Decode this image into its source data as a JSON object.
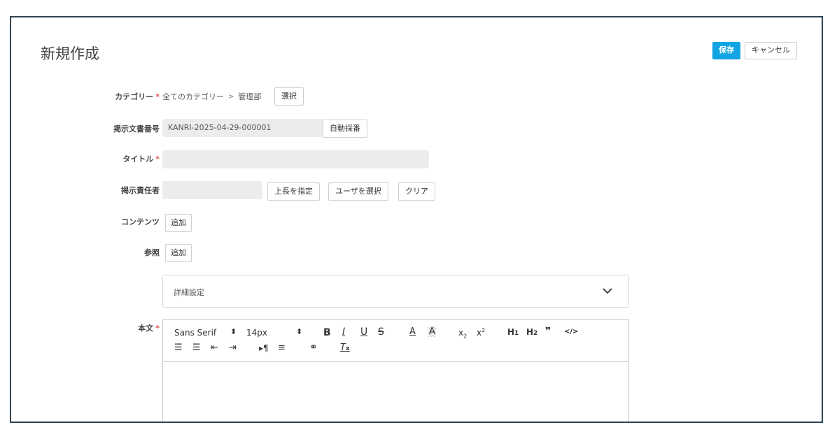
{
  "header": {
    "title": "新規作成",
    "save_label": "保存",
    "cancel_label": "キャンセル"
  },
  "form": {
    "category": {
      "label": "カテゴリー",
      "root": "全てのカテゴリー",
      "separator": ">",
      "current": "管理部",
      "button": "選択"
    },
    "doc_number": {
      "label": "掲示文書番号",
      "value": "KANRI-2025-04-29-000001",
      "button": "自動採番"
    },
    "title": {
      "label": "タイトル",
      "value": ""
    },
    "responsible": {
      "label": "掲示責任者",
      "value": "",
      "buttons": [
        "上長を指定",
        "ユーザを選択",
        "クリア"
      ]
    },
    "contents": {
      "label": "コンテンツ",
      "button": "追加"
    },
    "reference": {
      "label": "参照",
      "button": "追加"
    },
    "details": {
      "label": "詳細設定"
    },
    "body": {
      "label": "本文"
    },
    "required_mark": "*"
  },
  "editor": {
    "font": "Sans Serif",
    "size": "14px",
    "icons": [
      "bold-icon",
      "italic-icon",
      "underline-icon",
      "strike-icon",
      "font-color-icon",
      "background-color-icon",
      "subscript-icon",
      "superscript-icon",
      "h1-icon",
      "h2-icon",
      "blockquote-icon",
      "code-icon",
      "ordered-list-icon",
      "bullet-list-icon",
      "outdent-icon",
      "indent-icon",
      "text-direction-icon",
      "align-icon",
      "link-icon",
      "clear-format-icon"
    ]
  },
  "colors": {
    "primary": "#12a4e3",
    "required": "#d9534f",
    "frame": "#2f4454",
    "input_bg": "#ececec"
  }
}
